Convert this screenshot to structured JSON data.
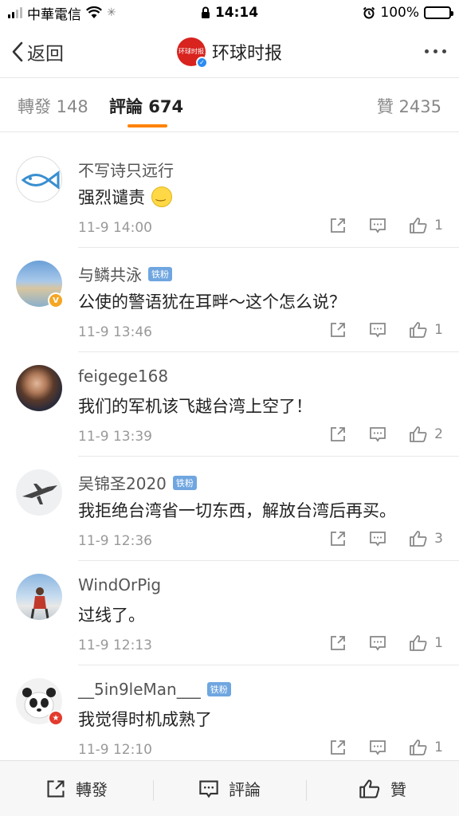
{
  "status_bar": {
    "carrier": "中華電信",
    "time": "14:14",
    "battery": "100%"
  },
  "nav": {
    "back_label": "返回",
    "account_name": "环球时报",
    "logo_text": "环球时报"
  },
  "tabs": {
    "repost": "轉發 148",
    "comment": "評論 674",
    "like": "贊 2435"
  },
  "comments": [
    {
      "user": "不写诗只远行",
      "badge": "",
      "text": "强烈谴责",
      "emoji": "smile",
      "time": "11-9 14:00",
      "likes": "1"
    },
    {
      "user": "与鳞共泳",
      "badge": "铁粉",
      "text": "公使的警语犹在耳畔～这个怎么说？",
      "emoji": "",
      "time": "11-9 13:46",
      "likes": "1"
    },
    {
      "user": "feigege168",
      "badge": "",
      "text": "我们的军机该飞越台湾上空了！",
      "emoji": "",
      "time": "11-9 13:39",
      "likes": "2"
    },
    {
      "user": "吴锦圣2020",
      "badge": "铁粉",
      "text": "我拒绝台湾省一切东西，解放台湾后再买。",
      "emoji": "",
      "time": "11-9 12:36",
      "likes": "3"
    },
    {
      "user": "WindOrPig",
      "badge": "",
      "text": "过线了。",
      "emoji": "",
      "time": "11-9 12:13",
      "likes": "1"
    },
    {
      "user": "__5in9leMan___",
      "badge": "铁粉",
      "text": "我觉得时机成熟了",
      "emoji": "",
      "time": "11-9 12:10",
      "likes": "1"
    }
  ],
  "bottom_bar": {
    "repost": "轉發",
    "comment": "評論",
    "like": "贊"
  },
  "colors": {
    "accent": "#ff8200",
    "verified_blue": "#2a8cf0",
    "brand_red": "#d8231f",
    "fan_badge": "#6fa6e0"
  }
}
